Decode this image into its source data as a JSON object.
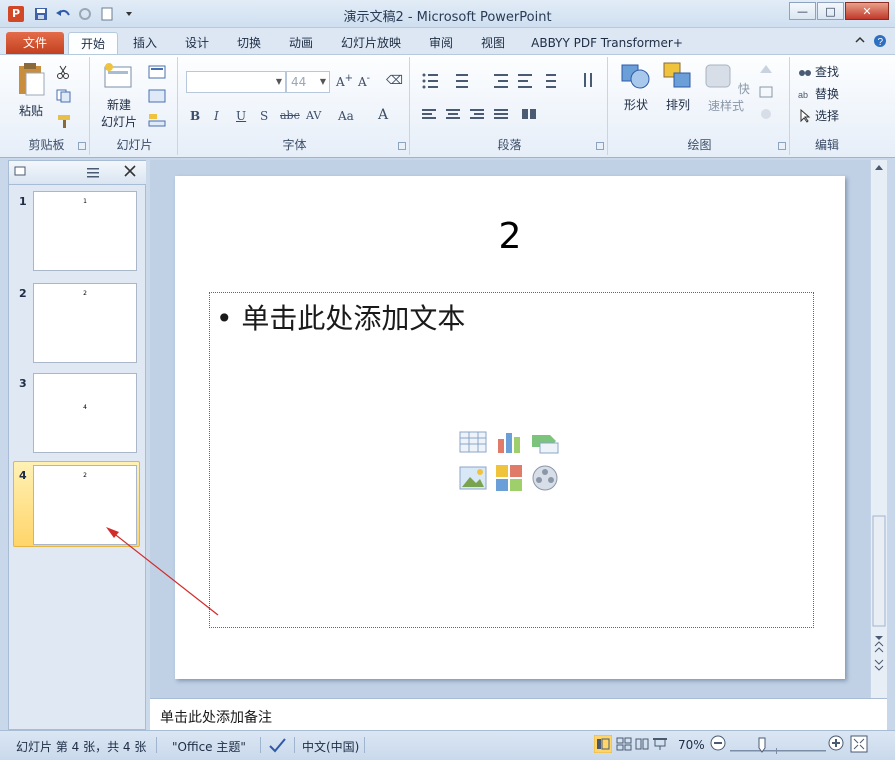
{
  "window": {
    "title": "演示文稿2 - Microsoft PowerPoint",
    "app_letter": "P",
    "controls": {
      "minimize": "—",
      "maximize": "□",
      "close": "✕"
    }
  },
  "tabs": [
    {
      "label": "文件",
      "kind": "file"
    },
    {
      "label": "开始",
      "kind": "active"
    },
    {
      "label": "插入"
    },
    {
      "label": "设计"
    },
    {
      "label": "切换"
    },
    {
      "label": "动画"
    },
    {
      "label": "幻灯片放映"
    },
    {
      "label": "审阅"
    },
    {
      "label": "视图"
    },
    {
      "label": "ABBYY PDF Transformer+"
    }
  ],
  "ribbon": {
    "clipboard": {
      "label": "剪贴板",
      "paste": "粘贴"
    },
    "slides": {
      "label": "幻灯片",
      "new_slide_line1": "新建",
      "new_slide_line2": "幻灯片"
    },
    "font": {
      "label": "字体",
      "font_name": "",
      "font_size": "44"
    },
    "paragraph": {
      "label": "段落"
    },
    "drawing": {
      "label": "绘图",
      "shapes": "形状",
      "arrange": "排列",
      "quick_styles": "快速样式"
    },
    "editing": {
      "label": "编辑",
      "find": "查找",
      "replace": "替换",
      "select": "选择"
    }
  },
  "slides": [
    {
      "number": "1",
      "thumb_title": "1"
    },
    {
      "number": "2",
      "thumb_title": "2"
    },
    {
      "number": "3",
      "thumb_title": "4"
    },
    {
      "number": "4",
      "thumb_title": "2",
      "selected": true
    }
  ],
  "current_slide": {
    "title": "2",
    "body_placeholder": "• 单击此处添加文本"
  },
  "notes": {
    "placeholder": "单击此处添加备注"
  },
  "status": {
    "slide_info": "幻灯片 第 4 张，共 4 张",
    "theme": "\"Office 主题\"",
    "language": "中文(中国)",
    "zoom": "70%"
  },
  "colors": {
    "file_tab": "#c2401f",
    "selection": "#ffd56a",
    "ribbon_bg": "#e6eef8",
    "annotation_arrow": "#d22b2b"
  }
}
